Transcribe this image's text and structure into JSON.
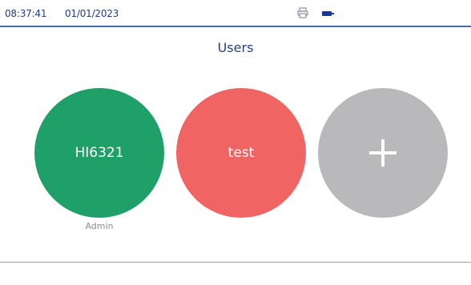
{
  "status_bar": {
    "time": "08:37:41",
    "date": "01/01/2023",
    "icons": [
      "printer-icon",
      "battery-icon"
    ]
  },
  "page": {
    "title": "Users"
  },
  "users": [
    {
      "name": "HI6321",
      "role": "Admin",
      "color": "#20a069"
    },
    {
      "name": "test",
      "role": "",
      "color": "#f06563"
    }
  ],
  "add_user": {
    "icon": "plus-icon",
    "color": "#b9b9bb"
  },
  "colors": {
    "accent": "#23418c",
    "divider": "#4a67a8"
  }
}
